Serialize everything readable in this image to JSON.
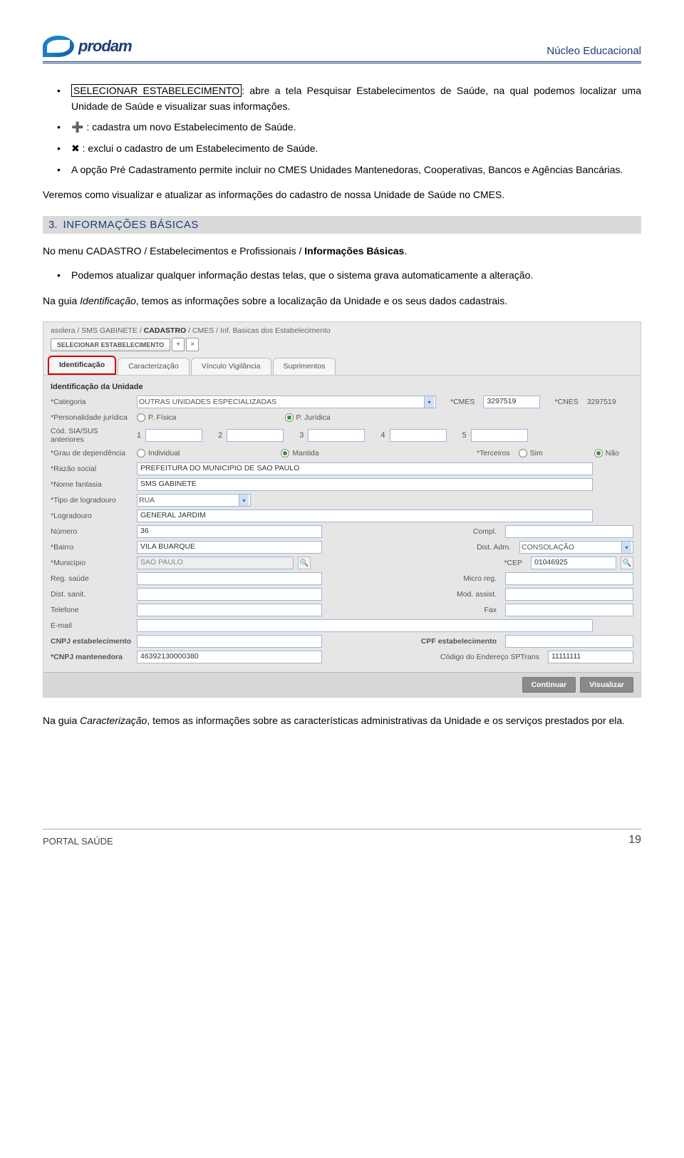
{
  "header": {
    "brand": "prodam",
    "title": "Núcleo Educacional"
  },
  "intro": {
    "b1_prefix": "SELECIONAR ESTABELECIMENTO",
    "b1_rest": ": abre a tela Pesquisar Estabelecimentos de Saúde, na qual podemos localizar uma Unidade de Saúde e visualizar suas informações.",
    "b2_icon": "➕",
    "b2_text": " : cadastra um novo Estabelecimento de Saúde.",
    "b3_icon": "✖",
    "b3_text": " : exclui o cadastro de um Estabelecimento de Saúde.",
    "b4": "A opção Pré Cadastramento permite incluir no CMES Unidades Mantenedoras, Cooperativas, Bancos e Agências Bancárias.",
    "p_after": "Veremos como visualizar e atualizar as informações do cadastro de nossa Unidade de Saúde no CMES."
  },
  "section": {
    "num": "3.",
    "title": "INFORMAÇÕES BÁSICAS",
    "p1_a": "No menu CADASTRO / ",
    "p1_b": "Estabelecimentos e Profissionais / ",
    "p1_c": "Informações Básicas",
    "p1_d": ".",
    "bullet": "Podemos atualizar qualquer informação destas telas, que o sistema grava automaticamente a alteração.",
    "p2_a": "Na guia ",
    "p2_b": "Identificação",
    "p2_c": ", temos as informações sobre a localização da Unidade e os seus dados cadastrais."
  },
  "ss": {
    "breadcrumb_a": "asolera / SMS GABINETE / ",
    "breadcrumb_b": "CADASTRO",
    "breadcrumb_c": " / CMES / Inf. Basicas dos Estabelecimento",
    "btn_select": "SELECIONAR  ESTABELECIMENTO",
    "icon_plus": "+",
    "icon_x": "×",
    "tabs": {
      "t1": "Identificação",
      "t2": "Caracterização",
      "t3": "Vínculo Vigilância",
      "t4": "Suprimentos"
    },
    "panel_title": "Identificação da Unidade",
    "labels": {
      "categoria": "Categoria",
      "cmes": "CMES",
      "cnes": "CNES",
      "personalidade": "Personalidade jurídica",
      "codsia": "Cód. SIA/SUS anteriores",
      "grau": "Grau de dependência",
      "terceiros": "Terceiros",
      "razao": "Razão social",
      "fantasia": "Nome fantasia",
      "tipolog": "Tipo de logradouro",
      "logradouro": "Logradouro",
      "numero": "Número",
      "compl": "Compl.",
      "bairro": "Bairro",
      "distadm": "Dist. Adm.",
      "municipio": "Município",
      "cep": "CEP",
      "regsaude": "Reg. saúde",
      "microreg": "Micro reg.",
      "distsanit": "Dist. sanit.",
      "modassist": "Mod. assist.",
      "telefone": "Telefone",
      "fax": "Fax",
      "email": "E-mail",
      "cnpj_estab": "CNPJ estabelecimento",
      "cpf_estab": "CPF estabelecimento",
      "cnpj_mant": "CNPJ mantenedora",
      "cod_end_sp": "Código do Endereço SPTrans"
    },
    "values": {
      "categoria": "OUTRAS UNIDADES ESPECIALIZADAS",
      "cmes": "3297519",
      "cnes": "3297519",
      "pfisica": "P. Física",
      "pjuridica": "P. Jurídica",
      "sia1": "1",
      "sia2": "2",
      "sia3": "3",
      "sia4": "4",
      "sia5": "5",
      "individual": "Individual",
      "mantida": "Mantida",
      "sim": "Sim",
      "nao": "Não",
      "razao": "PREFEITURA DO MUNICIPIO DE SAO PAULO",
      "fantasia": "SMS GABINETE",
      "tipolog": "RUA",
      "logradouro": "GENERAL JARDIM",
      "numero": "36",
      "bairro": "VILA BUARQUE",
      "distadm": "CONSOLAÇÃO",
      "municipio": "SAO PAULO",
      "cep": "01046925",
      "cnpj_mant": "46392130000380",
      "cod_end_sp": "11111111"
    },
    "actions": {
      "continuar": "Continuar",
      "visualizar": "Visualizar"
    }
  },
  "after_ss": {
    "a": "Na guia ",
    "b": "Caracterização",
    "c": ", temos as informações sobre as características administrativas da Unidade e os serviços prestados por ela."
  },
  "footer": {
    "left": "PORTAL SAÚDE",
    "right": "19"
  }
}
